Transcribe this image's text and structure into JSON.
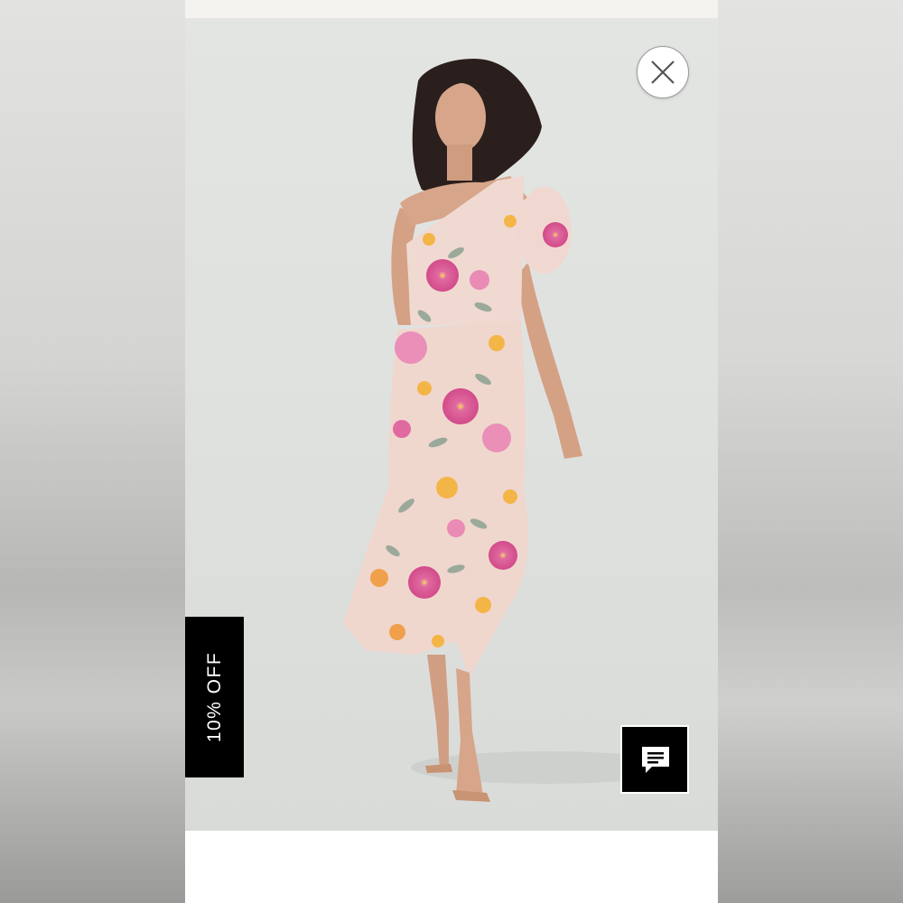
{
  "promo": {
    "discount_label": "10% OFF"
  },
  "icons": {
    "close": "close-icon",
    "chat": "chat-bubble-icon"
  },
  "colors": {
    "discount_tab_bg": "#000000",
    "chat_button_bg": "#000000",
    "photo_background": "#e0e2e0",
    "close_button_bg": "#ffffff"
  }
}
